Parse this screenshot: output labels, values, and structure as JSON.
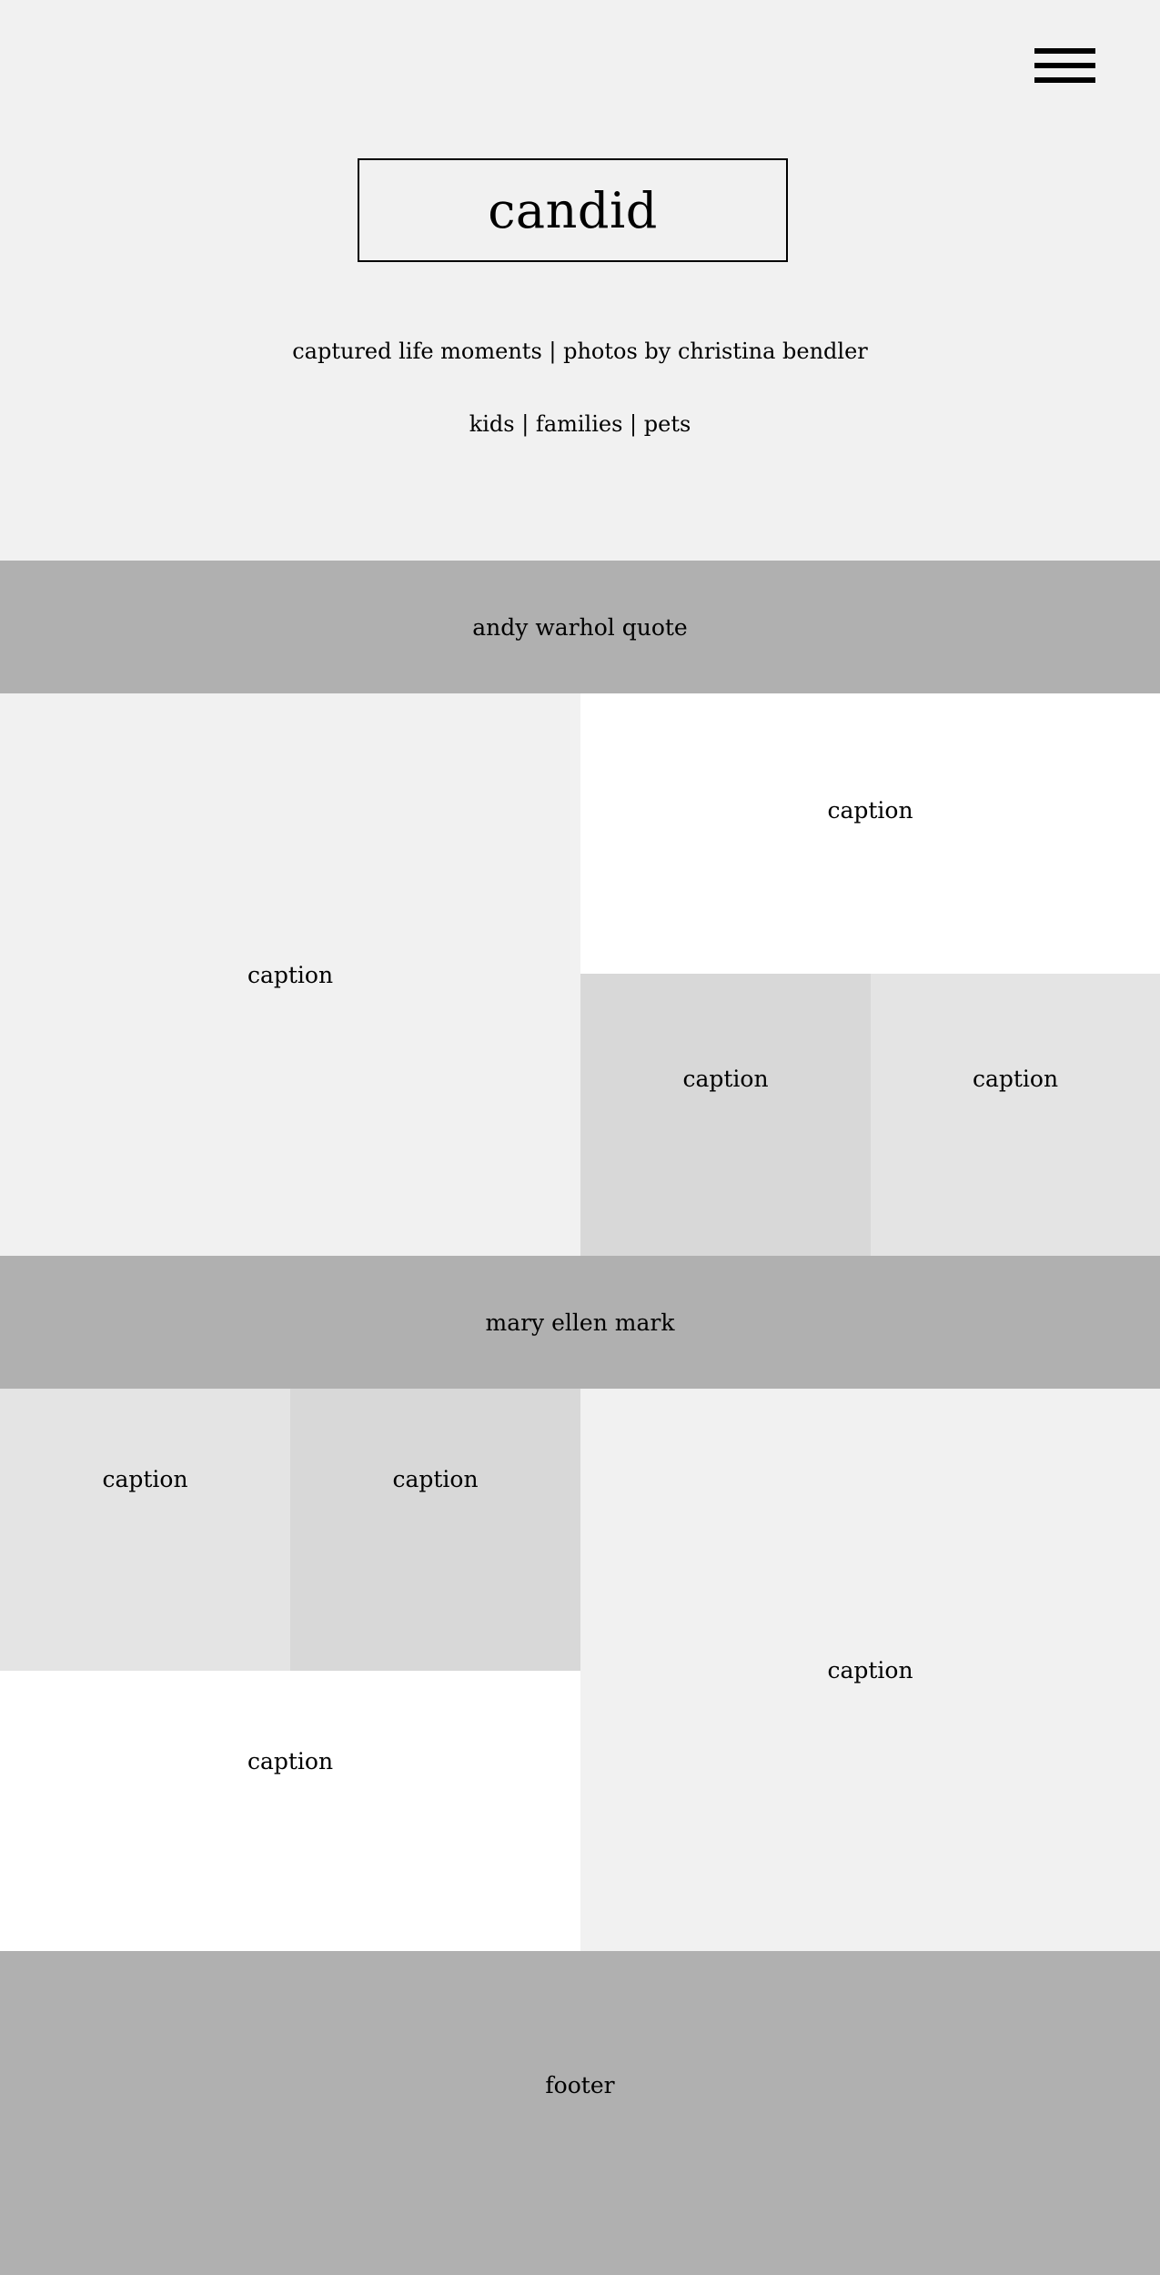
{
  "colors": {
    "header_bg": "#f1f1f1",
    "band_bg": "#b0b0b0",
    "tile_light": "#f1f1f1",
    "tile_mid": "#e4e4e4",
    "tile_dark": "#d8d8d8",
    "tile_white": "#ffffff",
    "text": "#000000"
  },
  "header": {
    "menu_icon": "hamburger-menu-icon",
    "logo": "candid",
    "tagline": "captured life moments | photos by christina bendler",
    "categories": "kids | families | pets"
  },
  "quote_band_1": {
    "label": "andy warhol quote"
  },
  "gallery_1": {
    "large": {
      "caption": "caption"
    },
    "top_right": {
      "caption": "caption"
    },
    "bottom_left_small": {
      "caption": "caption"
    },
    "bottom_right_small": {
      "caption": "caption"
    }
  },
  "quote_band_2": {
    "label": "mary ellen mark"
  },
  "gallery_2": {
    "top_left_small": {
      "caption": "caption"
    },
    "top_right_small": {
      "caption": "caption"
    },
    "bottom_wide": {
      "caption": "caption"
    },
    "large": {
      "caption": "caption"
    }
  },
  "footer": {
    "label": "footer"
  }
}
